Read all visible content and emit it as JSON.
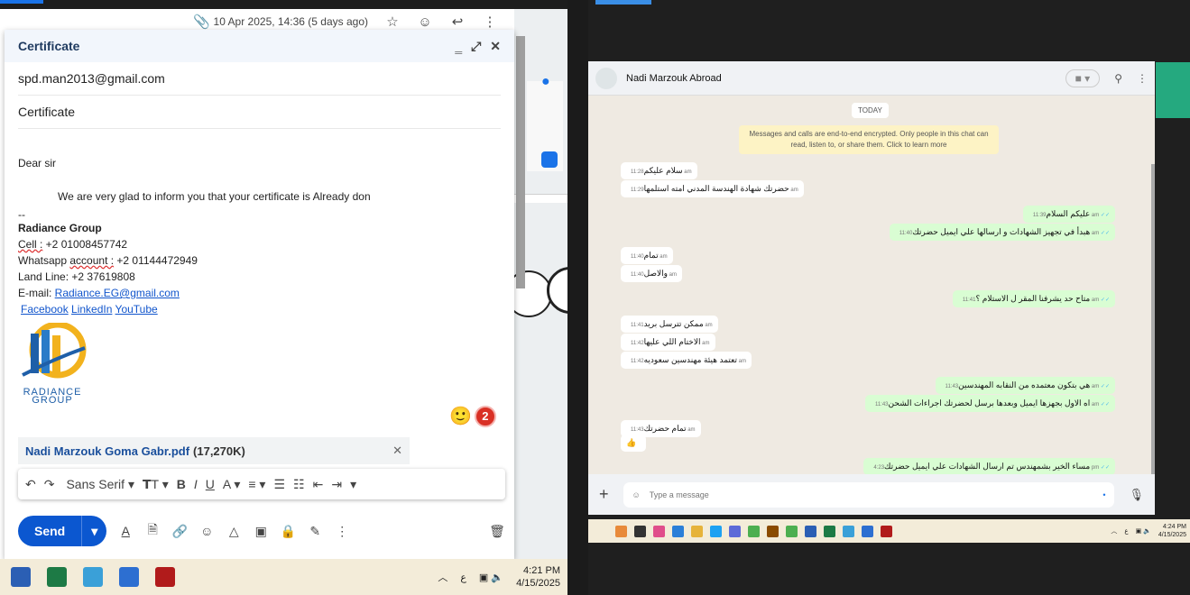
{
  "gmail": {
    "header_date": "10 Apr 2025, 14:36 (5 days ago)",
    "compose_title": "Certificate",
    "to": "spd.man2013@gmail.com",
    "subject": "Certificate",
    "greeting": "Dear sir",
    "body_line": "We are very glad to inform you that your certificate is Already don",
    "sig_sep": "--",
    "company": "Radiance Group",
    "cell_label": "Cell :",
    "cell_value": " +2 01008457742",
    "whatsapp_label_a": "Whatsapp ",
    "whatsapp_label_b": "account :",
    "whatsapp_value": " +2 01144472949",
    "landline": "Land Line: +2 37619808",
    "email_label": "E-mail: ",
    "email_value": "Radiance.EG@gmail.com",
    "links": [
      "Facebook",
      "LinkedIn",
      "YouTube"
    ],
    "logo_text_1": "RADIANCE",
    "logo_text_2": "GROUP",
    "emoji_badge": "2",
    "attachment_name": "Nadi Marzouk Goma Gabr.pdf",
    "attachment_size": "(17,270K)",
    "font_name": "Sans Serif",
    "send_label": "Send"
  },
  "taskbar_left": {
    "lang": "ع",
    "time": "4:21 PM",
    "date": "4/15/2025"
  },
  "whatsapp": {
    "contact": "Nadi Marzouk Abroad",
    "today": "TODAY",
    "encryption_notice": "Messages and calls are end-to-end encrypted. Only people in this chat can read, listen to, or share them. Click to learn more",
    "messages": [
      {
        "dir": "in",
        "text": "سلام عليكم",
        "time": "11:28 am"
      },
      {
        "dir": "in",
        "text": "حضرتك شهادة الهندسة المدني امته استلمها",
        "time": "11:29 am"
      },
      {
        "dir": "out",
        "text": "عليكم السلام",
        "time": "11:39 am"
      },
      {
        "dir": "out",
        "text": "هبدأ في تجهيز الشهادات و ارسالها علي ايميل حضرتك",
        "time": "11:40 am"
      },
      {
        "dir": "in",
        "text": "تمام",
        "time": "11:40 am"
      },
      {
        "dir": "in",
        "text": "والاصل",
        "time": "11:40 am"
      },
      {
        "dir": "out",
        "text": "متاح حد يشرفنا المقر ل الاستلام ؟",
        "time": "11:41 am"
      },
      {
        "dir": "in",
        "text": "ممكن تترسل بريد",
        "time": "11:41 am"
      },
      {
        "dir": "in",
        "text": "الاختام اللي عليها",
        "time": "11:42 am"
      },
      {
        "dir": "in",
        "text": "تعتمد هيئة مهندسين سعوديه",
        "time": "11:42 am"
      },
      {
        "dir": "out",
        "text": "هي بتكون معتمده من النقابه المهندسين",
        "time": "11:43 am"
      },
      {
        "dir": "out",
        "text": "اه الاول بجهزها ايميل وبعدها برسل لحضرتك اجراءات الشحن",
        "time": "11:43 am"
      },
      {
        "dir": "in",
        "text": "تمام حضرتك",
        "time": "11:43 am"
      },
      {
        "dir": "in",
        "text": "👍",
        "time": ""
      },
      {
        "dir": "out",
        "text": "مساء الخير بشمهندس تم ارسال الشهادات علي ايميل حضرتك",
        "time": "4:23 pm"
      }
    ],
    "input_placeholder": "Type a message"
  },
  "taskbar_right": {
    "lang": "ع",
    "time": "4:24 PM",
    "date": "4/15/2025"
  }
}
